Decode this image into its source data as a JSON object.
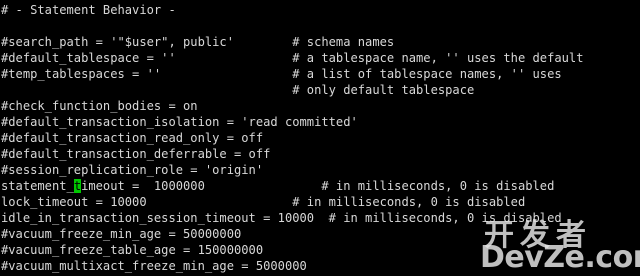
{
  "terminal": {
    "lines": [
      "# - Statement Behavior -",
      "",
      "#search_path = '\"$user\", public'        # schema names",
      "#default_tablespace = ''                # a tablespace name, '' uses the default",
      "#temp_tablespaces = ''                  # a list of tablespace names, '' uses",
      "                                        # only default tablespace",
      "#check_function_bodies = on",
      "#default_transaction_isolation = 'read committed'",
      "#default_transaction_read_only = off",
      "#default_transaction_deferrable = off",
      "#session_replication_role = 'origin'",
      "lock_timeout = 10000                    # in milliseconds, 0 is disabled",
      "idle_in_transaction_session_timeout = 10000  # in milliseconds, 0 is disabled",
      "#vacuum_freeze_min_age = 50000000",
      "#vacuum_freeze_table_age = 150000000",
      "#vacuum_multixact_freeze_min_age = 5000000"
    ],
    "cursor_line": {
      "before": "statement_",
      "cursor_char": "t",
      "after": "imeout =  1000000                # in milliseconds, 0 is disabled"
    }
  },
  "watermark": {
    "chinese": "开发者",
    "english": "DevZe.com"
  },
  "colors": {
    "background": "#000000",
    "text": "#d8d8d8",
    "cursor": "#00c800"
  }
}
